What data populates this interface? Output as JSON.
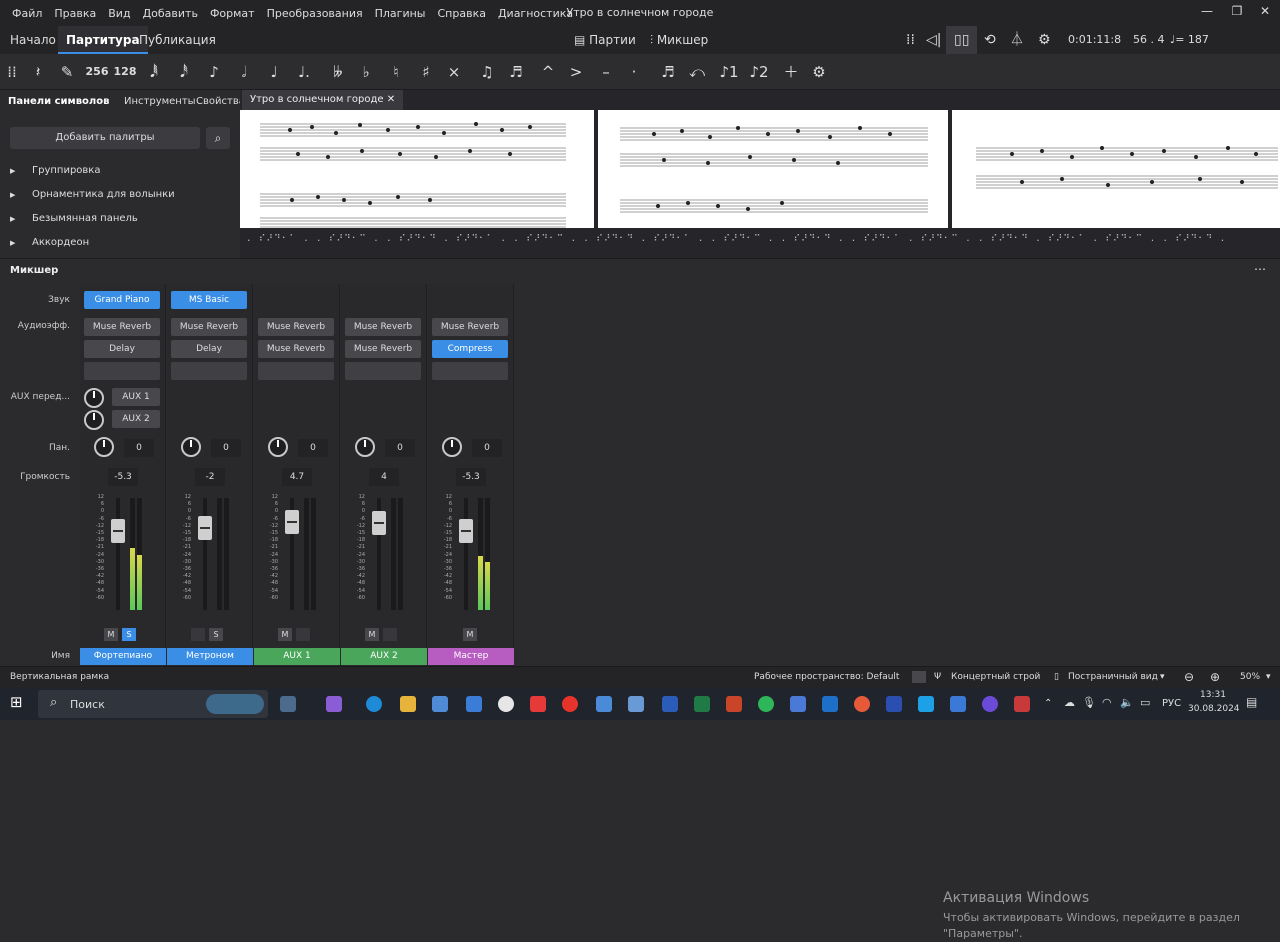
{
  "menu": [
    "Файл",
    "Правка",
    "Вид",
    "Добавить",
    "Формат",
    "Преобразования",
    "Плагины",
    "Справка",
    "Диагностика"
  ],
  "window_title": "Утро в солнечном городе",
  "tabs": {
    "home": "Начало",
    "score": "Партитура",
    "publish": "Публикация"
  },
  "header": {
    "parts": "Партии",
    "mixer": "Микшер",
    "time": "0:01:11:8",
    "position": "56 . 4",
    "tempo": "= 187"
  },
  "toolbar": {
    "dur256": "256",
    "dur128": "128"
  },
  "left_panel": {
    "tab_palettes": "Панели символов",
    "tab_instruments": "Инструменты",
    "tab_properties": "Свойства",
    "add_palettes": "Добавить палитры",
    "palettes": [
      "Группировка",
      "Орнаментика для волынки",
      "Безымянная панель",
      "Аккордеон"
    ]
  },
  "score_tab": "Утро в солнечном городе",
  "braille": ". ⠎⠜⠙⠂⠁ . . ⠎⠜⠙⠂⠉ . . ⠎⠜⠙⠂⠙ . ⠎⠜⠙⠂⠁ . . ⠎⠜⠙⠂⠉ . . ⠎⠜⠙⠂⠙ . ⠎⠜⠙⠂⠁ . . ⠎⠜⠙⠂⠉ . . ⠎⠜⠙⠂⠙ . . ⠎⠜⠙⠂⠁ . ⠎⠜⠙⠂⠉ . . ⠎⠜⠙⠂⠙ . ⠎⠜⠙⠂⠁ . ⠎⠜⠙⠂⠉ . . ⠎⠜⠙⠂⠙ .",
  "mixer": {
    "title": "Микшер",
    "labels": {
      "sound": "Звук",
      "effects": "Аудиоэфф.",
      "aux": "AUX перед...",
      "pan": "Пан.",
      "volume": "Громкость",
      "name": "Имя"
    },
    "aux1": "AUX 1",
    "aux2": "AUX 2",
    "scale": [
      "12",
      "6",
      "0",
      "-6",
      "-12",
      "-15",
      "-18",
      "-21",
      "-24",
      "-30",
      "-36",
      "-42",
      "-48",
      "-54",
      "-60"
    ],
    "strips": [
      {
        "sound": "Grand Piano",
        "fx1": "Muse Reverb",
        "fx2": "Delay",
        "pan": "0",
        "volume": "-5.3",
        "name": "Фортепиано",
        "name_color": "#3a8ee6",
        "mute": "M",
        "solo": "S",
        "solo_on": true,
        "meter_level": 0.55
      },
      {
        "sound": "MS Basic",
        "fx1": "Muse Reverb",
        "fx2": "Delay",
        "pan": "0",
        "volume": "-2",
        "name": "Метроном",
        "name_color": "#3a8ee6",
        "mute": "",
        "solo": "S",
        "solo_on": false,
        "meter_level": 0
      },
      {
        "sound": "",
        "fx1": "Muse Reverb",
        "fx2": "Muse Reverb",
        "pan": "0",
        "volume": "4.7",
        "name": "AUX 1",
        "name_color": "#49a65a",
        "mute": "M",
        "solo": "",
        "solo_on": false,
        "meter_level": 0
      },
      {
        "sound": "",
        "fx1": "Muse Reverb",
        "fx2": "Muse Reverb",
        "pan": "0",
        "volume": "4",
        "name": "AUX 2",
        "name_color": "#49a65a",
        "mute": "M",
        "solo": "",
        "solo_on": false,
        "meter_level": 0
      },
      {
        "sound": "",
        "fx1": "Muse Reverb",
        "fx2": "Compress",
        "pan": "0",
        "volume": "-5.3",
        "name": "Мастер",
        "name_color": "#b75cc0",
        "mute": "M",
        "solo": "",
        "solo_on": false,
        "meter_level": 0.48
      }
    ]
  },
  "activation": {
    "title": "Активация Windows",
    "text": "Чтобы активировать Windows, перейдите в раздел \"Параметры\"."
  },
  "status": {
    "left": "Вертикальная рамка",
    "workspace": "Рабочее пространство: Default",
    "concert": "Концертный строй",
    "view": "Постраничный вид",
    "zoom": "50%"
  },
  "taskbar": {
    "search": "Поиск",
    "lang": "РУС",
    "time": "13:31",
    "date": "30.08.2024"
  }
}
